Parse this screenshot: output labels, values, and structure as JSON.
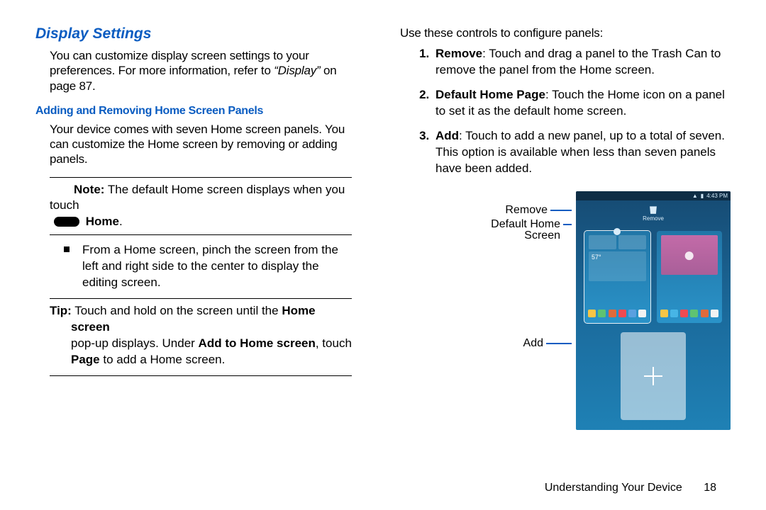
{
  "left": {
    "heading": "Display Settings",
    "intro_a": "You can customize display screen settings to your preferences. For more information, refer to ",
    "intro_ref": "“Display”",
    "intro_b": " on page 87.",
    "subheading": "Adding and Removing Home Screen Panels",
    "p2": "Your device comes with seven Home screen panels. You can customize the Home screen by removing or adding panels.",
    "note_label": "Note:",
    "note_a": " The default Home screen displays when you touch",
    "note_home": " Home",
    "note_end": ".",
    "bullet": "From a Home screen, pinch the screen from the left and right side to the center to display the editing screen.",
    "tip_label": "Tip:",
    "tip_a": " Touch and hold on the screen until the ",
    "tip_b1": "Home screen",
    "tip_c": " pop-up displays. Under ",
    "tip_b2": "Add to Home screen",
    "tip_d": ", touch ",
    "tip_b3": "Page",
    "tip_e": " to add a Home screen."
  },
  "right": {
    "lead": "Use these controls to configure panels:",
    "steps": [
      {
        "term": "Remove",
        "text": ": Touch and drag a panel to the Trash Can to remove the panel from the Home screen."
      },
      {
        "term": "Default Home Page",
        "text": ": Touch the Home icon on a panel to set it as the default home screen."
      },
      {
        "term": "Add",
        "text": ": Touch to add a new panel, up to a total of seven. This option is available when less than seven panels have been added."
      }
    ],
    "labels": {
      "remove": "Remove",
      "default_a": "Default Home",
      "default_b": "Screen",
      "add": "Add"
    },
    "phone": {
      "time": "4:43 PM",
      "remove_label": "Remove",
      "weather": "57°",
      "dock_colors": [
        "#f8c545",
        "#5ec372",
        "#e06a3b",
        "#f04a52",
        "#5aa0e0",
        "#f2f2f2"
      ],
      "dock_colors2": [
        "#f8c545",
        "#47b5e6",
        "#f04a52",
        "#5ec372",
        "#e06a3b",
        "#f2f2f2"
      ]
    }
  },
  "footer": {
    "section": "Understanding Your Device",
    "page": "18"
  }
}
